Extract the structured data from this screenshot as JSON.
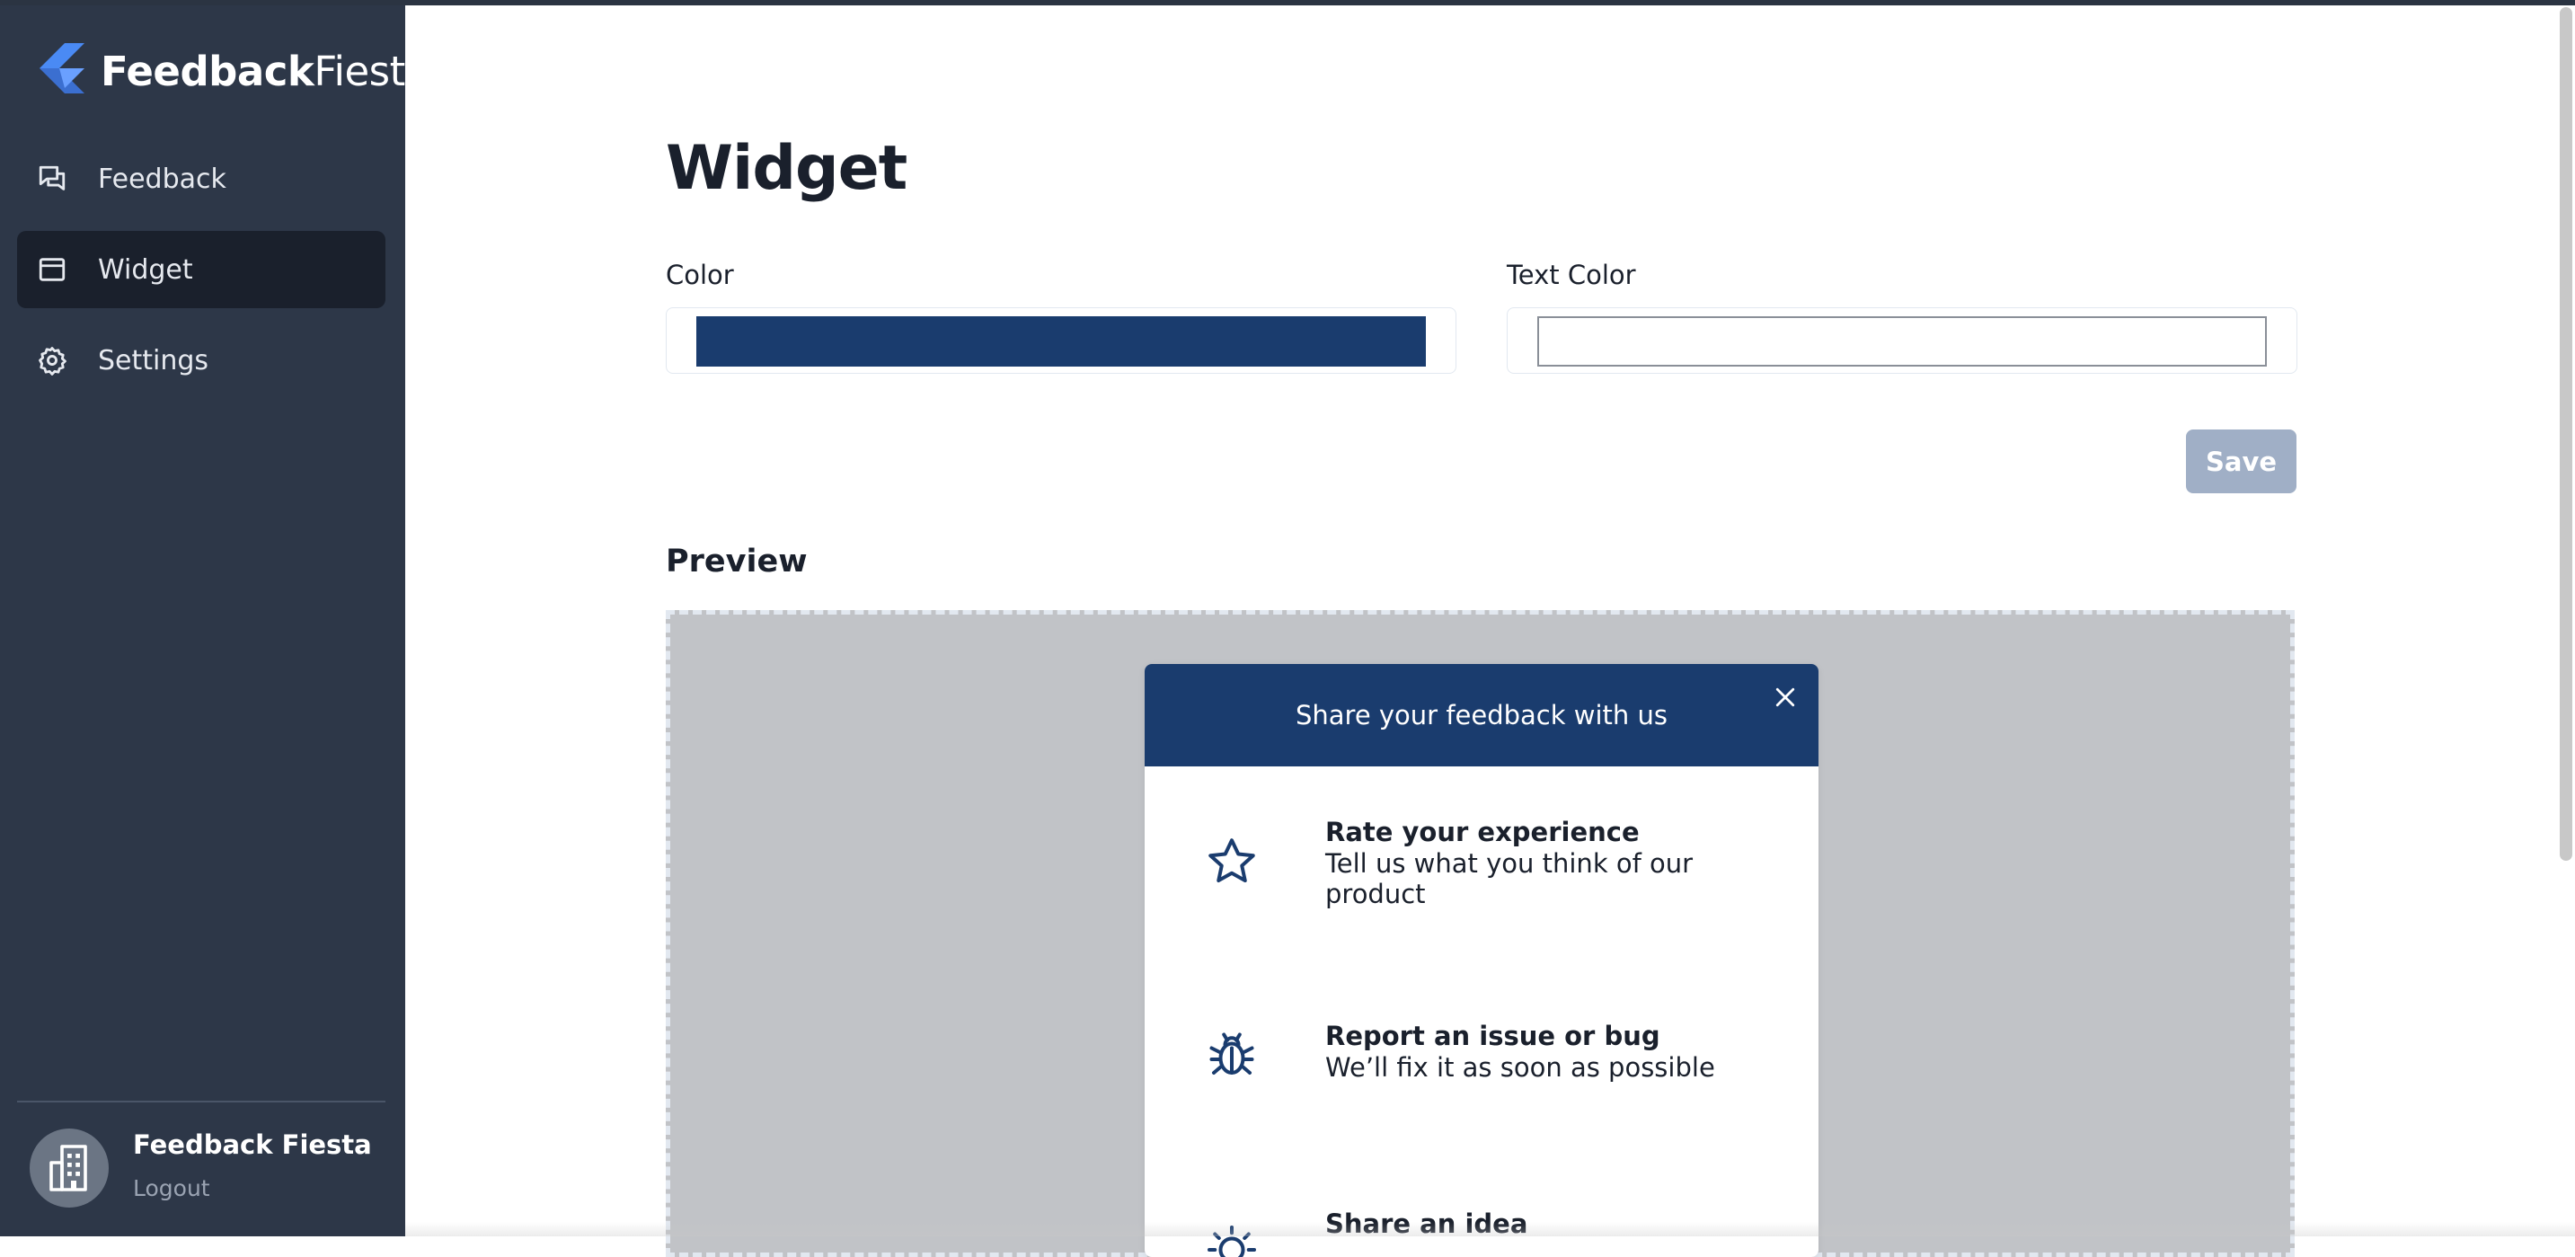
{
  "brand": {
    "name_bold": "Feedback",
    "name_light": "Fiesta",
    "logo_icon": "lightning-logo-icon"
  },
  "sidebar": {
    "items": [
      {
        "label": "Feedback",
        "icon": "chat-bubbles-icon",
        "active": false
      },
      {
        "label": "Widget",
        "icon": "window-icon",
        "active": true
      },
      {
        "label": "Settings",
        "icon": "gear-icon",
        "active": false
      }
    ],
    "account": {
      "name": "Feedback Fiesta",
      "logout_label": "Logout",
      "avatar_icon": "building-icon"
    }
  },
  "main": {
    "title": "Widget",
    "color_label": "Color",
    "color_value": "#1a3c6e",
    "text_color_label": "Text Color",
    "text_color_value": "#ffffff",
    "save_label": "Save",
    "preview_title": "Preview"
  },
  "widget_preview": {
    "header_text": "Share your feedback with us",
    "options": [
      {
        "title": "Rate your experience",
        "description": "Tell us what you think of our product",
        "icon": "star-icon"
      },
      {
        "title": "Report an issue or bug",
        "description": "We’ll fix it as soon as possible",
        "icon": "bug-icon"
      },
      {
        "title": "Share an idea",
        "description": "",
        "icon": "lightbulb-icon"
      }
    ]
  },
  "colors": {
    "sidebar_bg": "#2d3748",
    "active_nav_bg": "#1a202c",
    "accent": "#1a3c6e",
    "save_button_disabled": "#a0afc6",
    "preview_backdrop": "#c1c3c7"
  }
}
